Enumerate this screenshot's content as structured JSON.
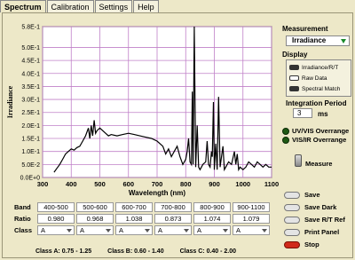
{
  "tabs": [
    {
      "label": "Spectrum",
      "active": true
    },
    {
      "label": "Calibration",
      "active": false
    },
    {
      "label": "Settings",
      "active": false
    },
    {
      "label": "Help",
      "active": false
    }
  ],
  "chart_data": {
    "type": "line",
    "xlabel": "Wavelength (nm)",
    "ylabel": "Irradiance",
    "xlim": [
      300,
      1100
    ],
    "ylim": [
      0,
      0.58
    ],
    "x_ticks": [
      "300",
      "400",
      "500",
      "600",
      "700",
      "800",
      "900",
      "1000",
      "1100"
    ],
    "y_ticks": [
      "0.0E+0",
      "5.0E-2",
      "1.0E-1",
      "1.5E-1",
      "2.0E-1",
      "2.5E-1",
      "3.0E-1",
      "3.5E-1",
      "4.0E-1",
      "4.5E-1",
      "5.0E-1",
      "5.8E-1"
    ],
    "grid": true,
    "line_color": "#000000",
    "grid_color": "#c080c8",
    "series": [
      {
        "values": [
          [
            340,
            0.02
          ],
          [
            350,
            0.035
          ],
          [
            360,
            0.05
          ],
          [
            370,
            0.07
          ],
          [
            380,
            0.09
          ],
          [
            390,
            0.1
          ],
          [
            400,
            0.11
          ],
          [
            410,
            0.105
          ],
          [
            420,
            0.115
          ],
          [
            430,
            0.12
          ],
          [
            440,
            0.14
          ],
          [
            450,
            0.16
          ],
          [
            460,
            0.19
          ],
          [
            465,
            0.15
          ],
          [
            470,
            0.2
          ],
          [
            475,
            0.16
          ],
          [
            480,
            0.22
          ],
          [
            485,
            0.17
          ],
          [
            490,
            0.18
          ],
          [
            500,
            0.19
          ],
          [
            510,
            0.18
          ],
          [
            520,
            0.17
          ],
          [
            530,
            0.16
          ],
          [
            540,
            0.165
          ],
          [
            560,
            0.16
          ],
          [
            580,
            0.165
          ],
          [
            600,
            0.17
          ],
          [
            620,
            0.165
          ],
          [
            640,
            0.16
          ],
          [
            660,
            0.155
          ],
          [
            680,
            0.15
          ],
          [
            700,
            0.14
          ],
          [
            720,
            0.12
          ],
          [
            730,
            0.09
          ],
          [
            740,
            0.11
          ],
          [
            750,
            0.08
          ],
          [
            760,
            0.1
          ],
          [
            770,
            0.12
          ],
          [
            780,
            0.08
          ],
          [
            790,
            0.05
          ],
          [
            800,
            0.07
          ],
          [
            805,
            0.1
          ],
          [
            810,
            0.15
          ],
          [
            815,
            0.06
          ],
          [
            820,
            0.05
          ],
          [
            823,
            0.33
          ],
          [
            826,
            0.05
          ],
          [
            830,
            0.58
          ],
          [
            835,
            0.04
          ],
          [
            840,
            0.2
          ],
          [
            845,
            0.04
          ],
          [
            850,
            0.03
          ],
          [
            860,
            0.05
          ],
          [
            870,
            0.06
          ],
          [
            875,
            0.14
          ],
          [
            880,
            0.05
          ],
          [
            885,
            0.04
          ],
          [
            890,
            0.1
          ],
          [
            893,
            0.08
          ],
          [
            897,
            0.29
          ],
          [
            900,
            0.03
          ],
          [
            905,
            0.13
          ],
          [
            910,
            0.03
          ],
          [
            915,
            0.31
          ],
          [
            920,
            0.04
          ],
          [
            930,
            0.12
          ],
          [
            935,
            0.03
          ],
          [
            940,
            0.04
          ],
          [
            950,
            0.06
          ],
          [
            960,
            0.05
          ],
          [
            970,
            0.1
          ],
          [
            975,
            0.05
          ],
          [
            980,
            0.09
          ],
          [
            985,
            0.03
          ],
          [
            990,
            0.04
          ],
          [
            1000,
            0.03
          ],
          [
            1010,
            0.04
          ],
          [
            1020,
            0.06
          ],
          [
            1030,
            0.05
          ],
          [
            1040,
            0.04
          ],
          [
            1050,
            0.06
          ],
          [
            1060,
            0.05
          ],
          [
            1070,
            0.04
          ],
          [
            1080,
            0.05
          ],
          [
            1090,
            0.04
          ],
          [
            1100,
            0.04
          ]
        ]
      }
    ]
  },
  "measurement": {
    "label": "Measurement",
    "value": "Irradiance"
  },
  "display": {
    "label": "Display",
    "items": [
      {
        "label": "Irradiance/R/T",
        "on": true
      },
      {
        "label": "Raw Data",
        "on": false
      },
      {
        "label": "Spectral Match",
        "on": true
      }
    ]
  },
  "integration": {
    "label": "Integration Period",
    "value": "3",
    "unit": "ms"
  },
  "leds": {
    "uv": "UV/VIS Overrange",
    "vis": "VIS/IR Overrange"
  },
  "measure_label": "Measure",
  "buttons": {
    "save": "Save",
    "save_dark": "Save Dark",
    "save_rt": "Save R/T Ref",
    "print": "Print Panel",
    "stop": "Stop"
  },
  "table": {
    "band_label": "Band",
    "ratio_label": "Ratio",
    "class_label": "Class",
    "bands": [
      "400-500",
      "500-600",
      "600-700",
      "700-800",
      "800-900",
      "900-1100"
    ],
    "ratios": [
      "0.980",
      "0.968",
      "1.038",
      "0.873",
      "1.074",
      "1.079"
    ],
    "classes": [
      "A",
      "A",
      "A",
      "A",
      "A",
      "A"
    ]
  },
  "class_ranges": {
    "a": "Class A:  0.75 - 1.25",
    "b": "Class B:  0.60 - 1.40",
    "c": "Class C:  0.40 - 2.00"
  }
}
